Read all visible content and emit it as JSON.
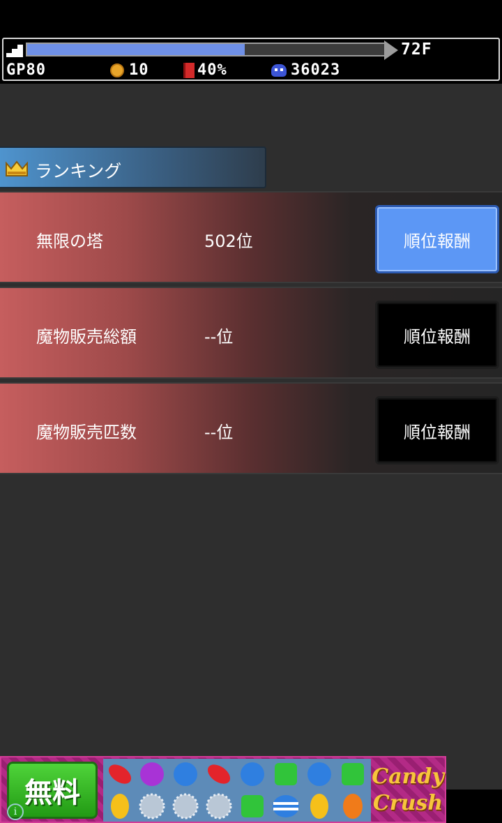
{
  "hud": {
    "floor": "72F",
    "progress_fraction": 0.61,
    "gp": "GP80",
    "coins": "10",
    "percent": "40%",
    "monsters": "36023"
  },
  "ranking": {
    "title": "ランキング",
    "rows": [
      {
        "name": "無限の塔",
        "rank": "502位",
        "button": "順位報酬",
        "active": true
      },
      {
        "name": "魔物販売総額",
        "rank": "--位",
        "button": "順位報酬",
        "active": false
      },
      {
        "name": "魔物販売匹数",
        "rank": "--位",
        "button": "順位報酬",
        "active": false
      }
    ]
  },
  "ad": {
    "free_label": "無料",
    "logo_line1": "Candy",
    "logo_line2": "Crush",
    "info_icon": "i"
  },
  "colors": {
    "accent_blue": "#5c97f5",
    "row_red": "#c65e5e",
    "progress": "#6f90e6"
  }
}
